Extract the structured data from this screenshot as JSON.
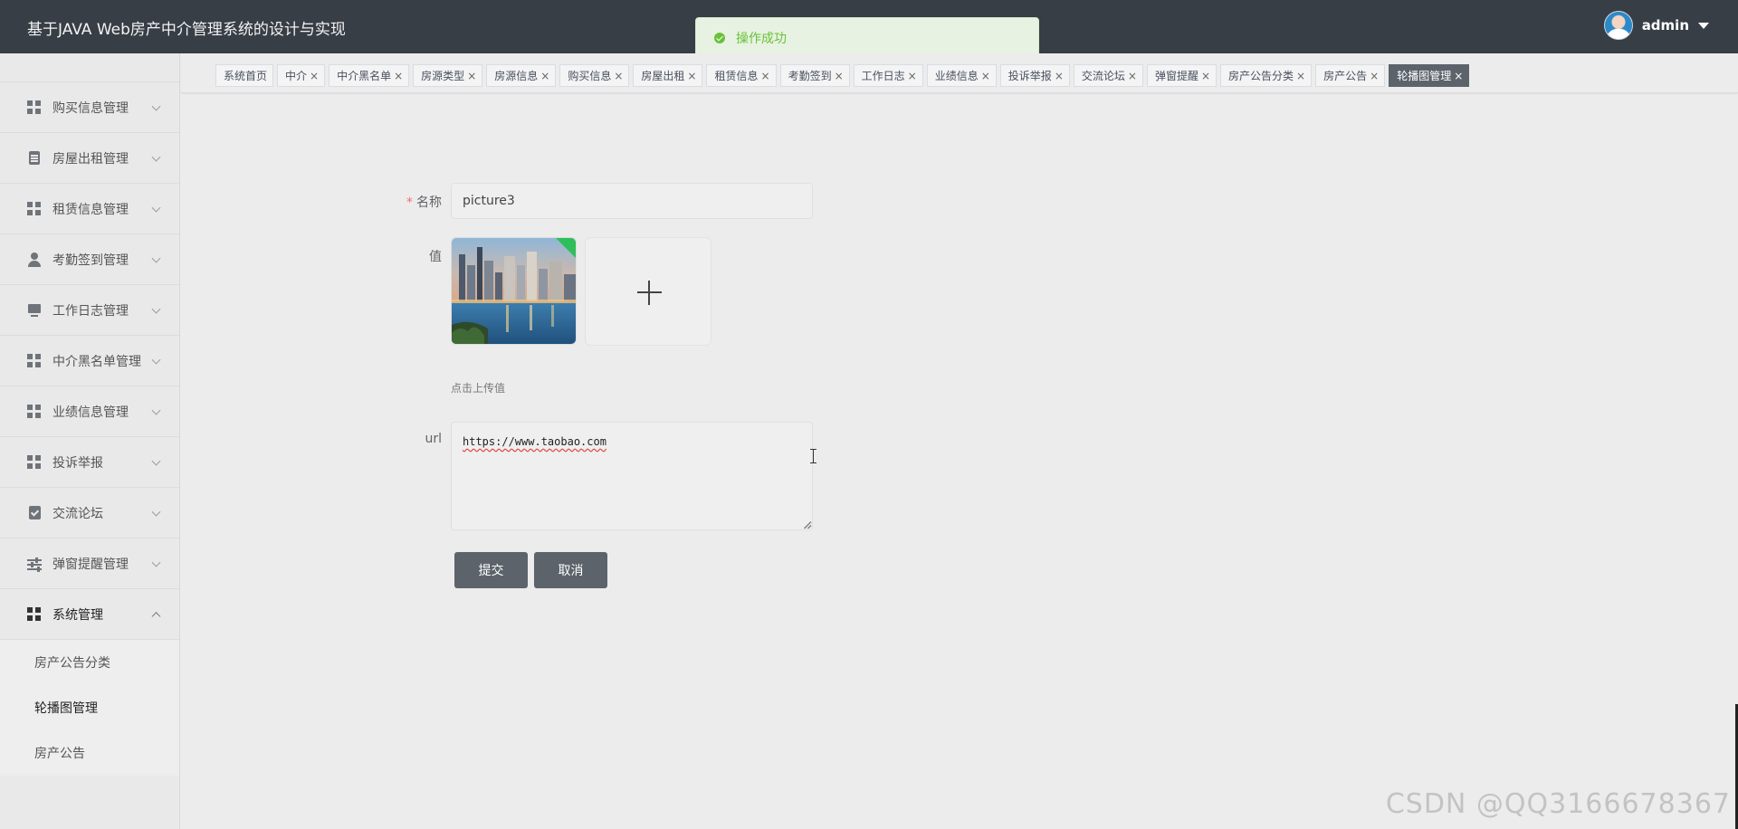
{
  "app": {
    "title": "基于JAVA Web房产中介管理系统的设计与实现"
  },
  "user": {
    "name": "admin"
  },
  "toast": {
    "message": "操作成功",
    "type": "success",
    "color": "#67c23a"
  },
  "sidebar": {
    "items": [
      {
        "label": "购买信息管理",
        "icon": "grid-icon"
      },
      {
        "label": "房屋出租管理",
        "icon": "clipboard-icon"
      },
      {
        "label": "租赁信息管理",
        "icon": "grid-icon"
      },
      {
        "label": "考勤签到管理",
        "icon": "user-icon"
      },
      {
        "label": "工作日志管理",
        "icon": "monitor-icon"
      },
      {
        "label": "中介黑名单管理",
        "icon": "grid-icon"
      },
      {
        "label": "业绩信息管理",
        "icon": "grid-icon"
      },
      {
        "label": "投诉举报",
        "icon": "grid-icon"
      },
      {
        "label": "交流论坛",
        "icon": "check-icon"
      },
      {
        "label": "弹窗提醒管理",
        "icon": "sliders-icon"
      },
      {
        "label": "系统管理",
        "icon": "grid-icon",
        "expanded": true
      }
    ],
    "submenu": [
      {
        "label": "房产公告分类"
      },
      {
        "label": "轮播图管理",
        "active": true
      },
      {
        "label": "房产公告"
      }
    ]
  },
  "tabs": [
    {
      "label": "系统首页",
      "closable": false
    },
    {
      "label": "中介",
      "closable": true
    },
    {
      "label": "中介黑名单",
      "closable": true
    },
    {
      "label": "房源类型",
      "closable": true
    },
    {
      "label": "房源信息",
      "closable": true
    },
    {
      "label": "购买信息",
      "closable": true
    },
    {
      "label": "房屋出租",
      "closable": true
    },
    {
      "label": "租赁信息",
      "closable": true
    },
    {
      "label": "考勤签到",
      "closable": true
    },
    {
      "label": "工作日志",
      "closable": true
    },
    {
      "label": "业绩信息",
      "closable": true
    },
    {
      "label": "投诉举报",
      "closable": true
    },
    {
      "label": "交流论坛",
      "closable": true
    },
    {
      "label": "弹窗提醒",
      "closable": true
    },
    {
      "label": "房产公告分类",
      "closable": true
    },
    {
      "label": "房产公告",
      "closable": true
    },
    {
      "label": "轮播图管理",
      "closable": true,
      "active": true
    }
  ],
  "form": {
    "name_label": "名称",
    "name_value": "picture3",
    "value_label": "值",
    "upload_tip": "点击上传值",
    "url_label": "url",
    "url_value": "https://www.taobao.com",
    "submit_label": "提交",
    "cancel_label": "取消"
  },
  "watermark": "CSDN @QQ3166678367",
  "colors": {
    "topbar": "#383e46",
    "button": "#5c636b",
    "required": "#f56c6c"
  }
}
